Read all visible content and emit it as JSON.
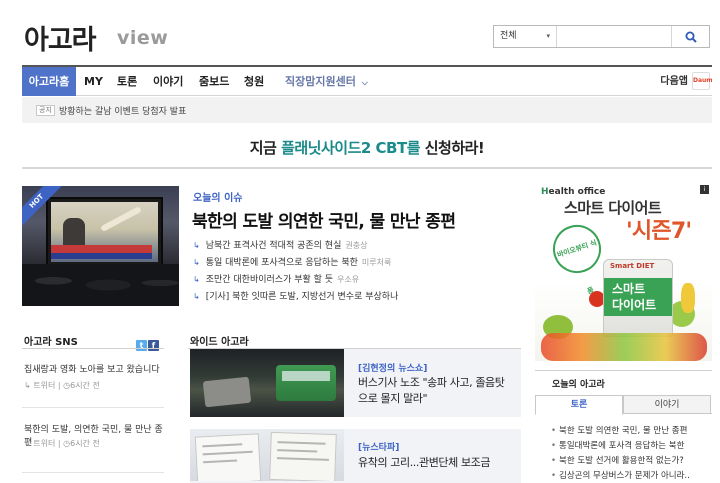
{
  "header": {
    "logo": "아고라",
    "logo_sub": "view",
    "search": {
      "scope": "전체",
      "placeholder": ""
    }
  },
  "nav": {
    "items": [
      "아고라홈",
      "MY",
      "토론",
      "이야기",
      "줌보드",
      "청원",
      "직장맘지원센터"
    ],
    "daum_label": "다음앱",
    "daum_badge": "Daum"
  },
  "notice": {
    "tag": "공지",
    "text": "방황하는 갈남 이벤트 당첨자 발표"
  },
  "banner": {
    "prefix": "지금 ",
    "highlight": "플래닛사이드2 CBT를",
    "suffix": " 신청하라!"
  },
  "issue": {
    "hot_label": "HOT",
    "category": "오늘의 이슈",
    "title": "북한의 도발 의연한 국민, 물 만난 종편",
    "items": [
      {
        "text": "남북간 표격사건 적대적 공존의 현실",
        "author": "권충상"
      },
      {
        "text": "통일 대박론에 포사격으로 응답하는 북한",
        "author": "미루처룩"
      },
      {
        "text": "조만간 대한바이러스가 부활 할 듯",
        "author": "우소유"
      },
      {
        "text": "[기사] 북한 잇따른 도발, 지방선거 변수로 부상하나",
        "author": ""
      }
    ]
  },
  "sns": {
    "title": "아고라 SNS",
    "posts": [
      {
        "text": "집새랑과 영화 노아를 보고 왔습니다",
        "source": "트위터",
        "time": "6시간 전"
      },
      {
        "text": "북한의 도발, 의연한 국민, 물 만난 종편",
        "source": "트위터",
        "time": "6시간 전"
      }
    ]
  },
  "wide": {
    "title": "와이드 아고라",
    "cards": [
      {
        "tag": "[김현정의 뉴스쇼]",
        "text": "버스기사 노조 \"송파 사고, 졸음탓으로 몰지 말라\""
      },
      {
        "tag": "[뉴스타파]",
        "text": "유착의 고리...관변단체 보조금"
      }
    ]
  },
  "ad": {
    "brand_h": "H",
    "brand_rest": "ealth office",
    "title1": "스마트 다이어트",
    "title2": "'시즌7'",
    "stamp": "바이오뷰티 식품",
    "pack_label": "Smart DIET",
    "pack_line1": "스마트",
    "pack_line2": "다이어트",
    "corner": "i"
  },
  "today": {
    "title": "오늘의 아고라",
    "tabs": [
      "토론",
      "이야기"
    ],
    "items": [
      "북한 도발 의연한 국민, 물 만난 종편",
      "통일대박론에 포사격 응답하는 북한",
      "북한 도발 선거에 활용한적 없는가?",
      "김상곤의 무상버스가 문제가 아니라.."
    ]
  },
  "colors": {
    "accent": "#4f73c9",
    "link_blue": "#3d63c4",
    "banner_highlight": "#1b8a8a",
    "ad_orange": "#e0562a",
    "ad_green": "#3aa255"
  }
}
